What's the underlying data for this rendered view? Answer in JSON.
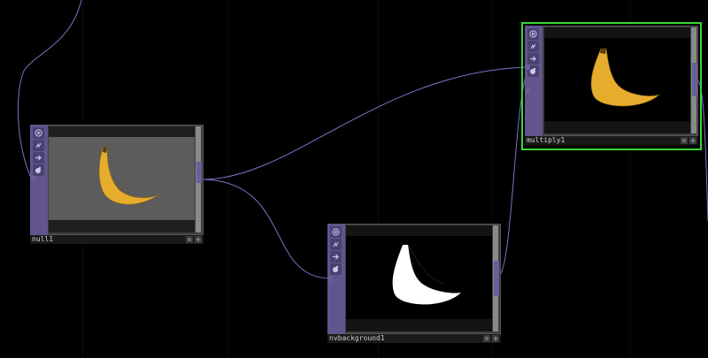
{
  "network": {
    "background": "#000000",
    "wire_color": "#7f72c8",
    "selection_color": "#35d835"
  },
  "nodes": {
    "null": {
      "name": "null1",
      "viewer_background": "#5c5c5c",
      "content": "banana-image"
    },
    "nvbackground": {
      "name": "nvbackground1",
      "viewer_background": "#000000",
      "content": "banana-matte"
    },
    "multiply": {
      "name": "multiply1",
      "viewer_background": "#000000",
      "content": "banana-cutout",
      "selected": true
    }
  },
  "side_icons": [
    "close-icon",
    "bypass-icon",
    "arrow-right-icon",
    "viewer-icon"
  ],
  "label_buttons": [
    "viewer-toggle-icon",
    "plus-icon"
  ]
}
